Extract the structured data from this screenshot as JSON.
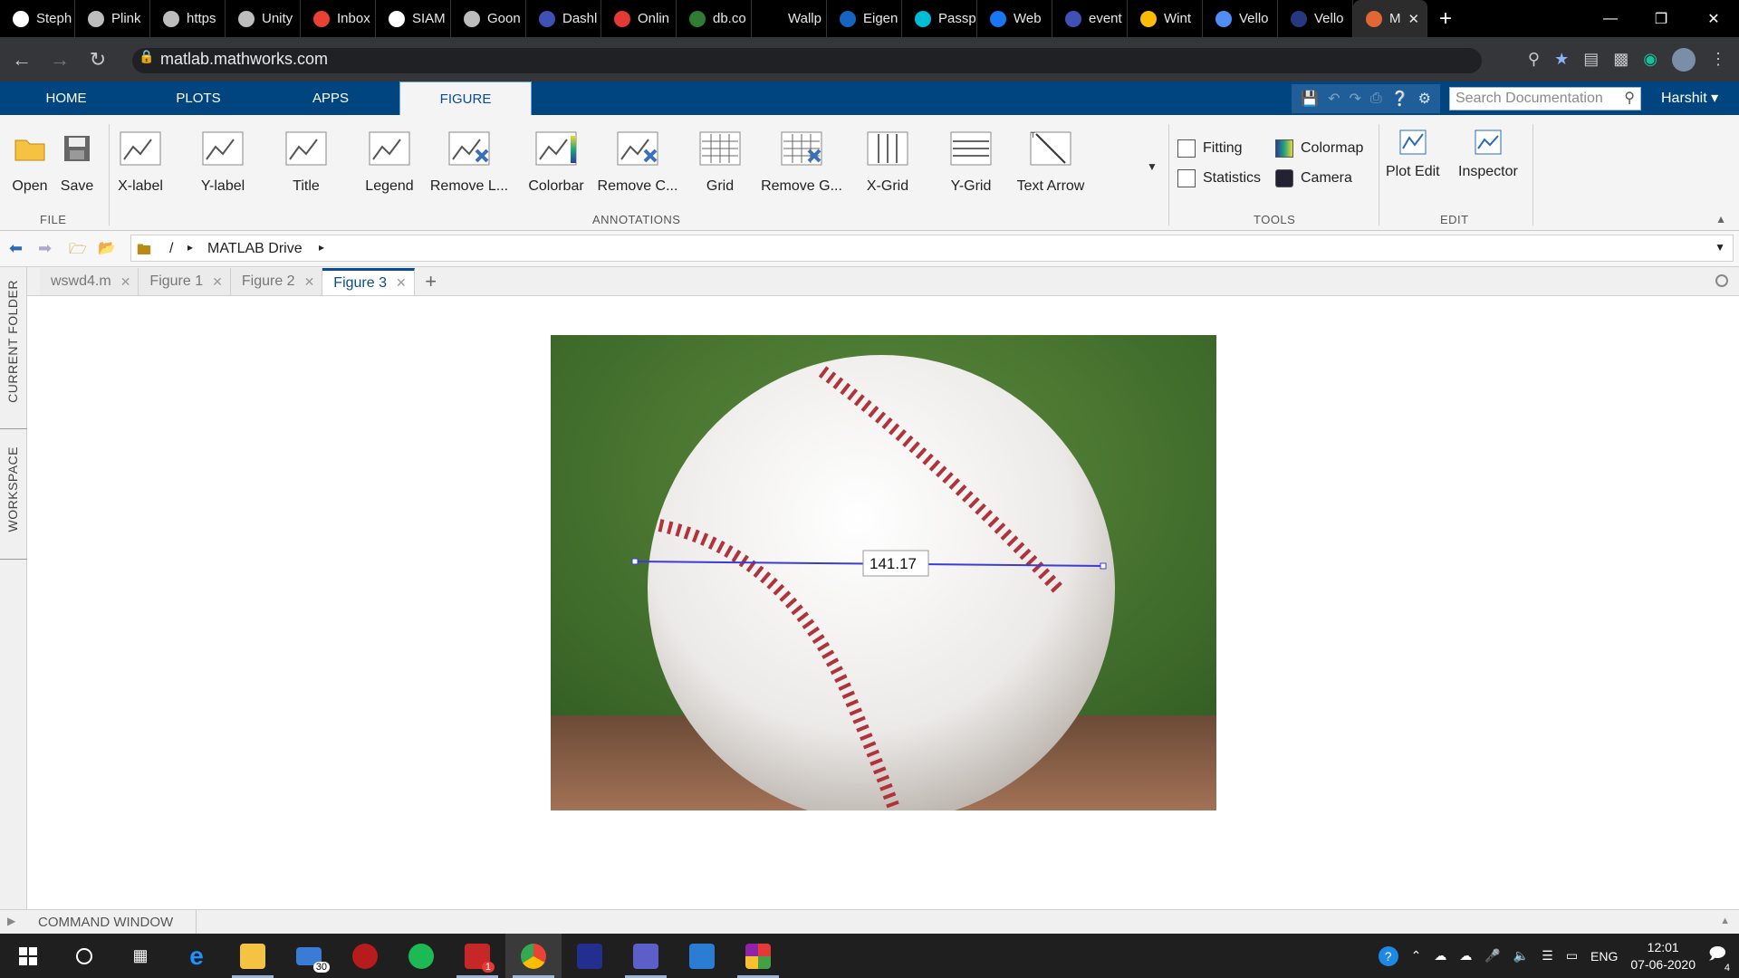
{
  "browser": {
    "tabs": [
      {
        "label": "Steph",
        "icon": "github-icon",
        "color": "#ffffff"
      },
      {
        "label": "Plink",
        "icon": "globe-icon",
        "color": "#bdbdbd"
      },
      {
        "label": "https",
        "icon": "globe-icon",
        "color": "#bdbdbd"
      },
      {
        "label": "Unity",
        "icon": "unity-icon",
        "color": "#bdbdbd"
      },
      {
        "label": "Inbox",
        "icon": "gmail-icon",
        "color": "#e94235"
      },
      {
        "label": "SIAM",
        "icon": "github-icon",
        "color": "#ffffff"
      },
      {
        "label": "Goon",
        "icon": "user-icon",
        "color": "#bdbdbd"
      },
      {
        "label": "Dashl",
        "icon": "dash-icon",
        "color": "#3f51b5"
      },
      {
        "label": "Onlin",
        "icon": "online-icon",
        "color": "#e53935"
      },
      {
        "label": "db.co",
        "icon": "leaf-icon",
        "color": "#2e7d32"
      },
      {
        "label": "Wallp",
        "icon": "blank-icon",
        "color": "#000000"
      },
      {
        "label": "Eigen",
        "icon": "grid-icon",
        "color": "#1565c0"
      },
      {
        "label": "Passp",
        "icon": "p-icon",
        "color": "#00bcd4"
      },
      {
        "label": "Web",
        "icon": "facebook-icon",
        "color": "#1877f2"
      },
      {
        "label": "event",
        "icon": "event-icon",
        "color": "#3f51b5"
      },
      {
        "label": "Wint",
        "icon": "drive-icon",
        "color": "#fbbc04"
      },
      {
        "label": "Vello",
        "icon": "infinity-icon",
        "color": "#4f8ef7"
      },
      {
        "label": "Vello",
        "icon": "vello-icon",
        "color": "#263880"
      },
      {
        "label": "M",
        "icon": "matlab-icon",
        "color": "#e16737"
      }
    ],
    "url": "matlab.mathworks.com"
  },
  "matlab": {
    "tabs": [
      "HOME",
      "PLOTS",
      "APPS",
      "FIGURE"
    ],
    "search_placeholder": "Search Documentation",
    "user": "Harshit",
    "file": {
      "open": "Open",
      "save": "Save",
      "section": "FILE"
    },
    "annotations": {
      "items": [
        "X-label",
        "Y-label",
        "Title",
        "Legend",
        "Remove L...",
        "Colorbar",
        "Remove C...",
        "Grid",
        "Remove G...",
        "X-Grid",
        "Y-Grid",
        "Text Arrow"
      ],
      "section": "ANNOTATIONS"
    },
    "tools": {
      "fitting": "Fitting",
      "statistics": "Statistics",
      "colormap": "Colormap",
      "camera": "Camera",
      "section": "TOOLS"
    },
    "edit": {
      "plot_edit": "Plot Edit",
      "inspector": "Inspector",
      "section": "EDIT"
    },
    "path": {
      "root": "/",
      "folder": "MATLAB Drive"
    },
    "doc_tabs": [
      "wswd4.m",
      "Figure 1",
      "Figure 2",
      "Figure 3"
    ],
    "side_panels": [
      "CURRENT FOLDER",
      "WORKSPACE"
    ],
    "figure": {
      "measurement": "141.17"
    },
    "command_window": "COMMAND WINDOW"
  },
  "taskbar": {
    "mail_badge": "30",
    "app_badge": "1",
    "lang": "ENG",
    "time": "12:01",
    "date": "07-06-2020",
    "notif_count": "4"
  }
}
